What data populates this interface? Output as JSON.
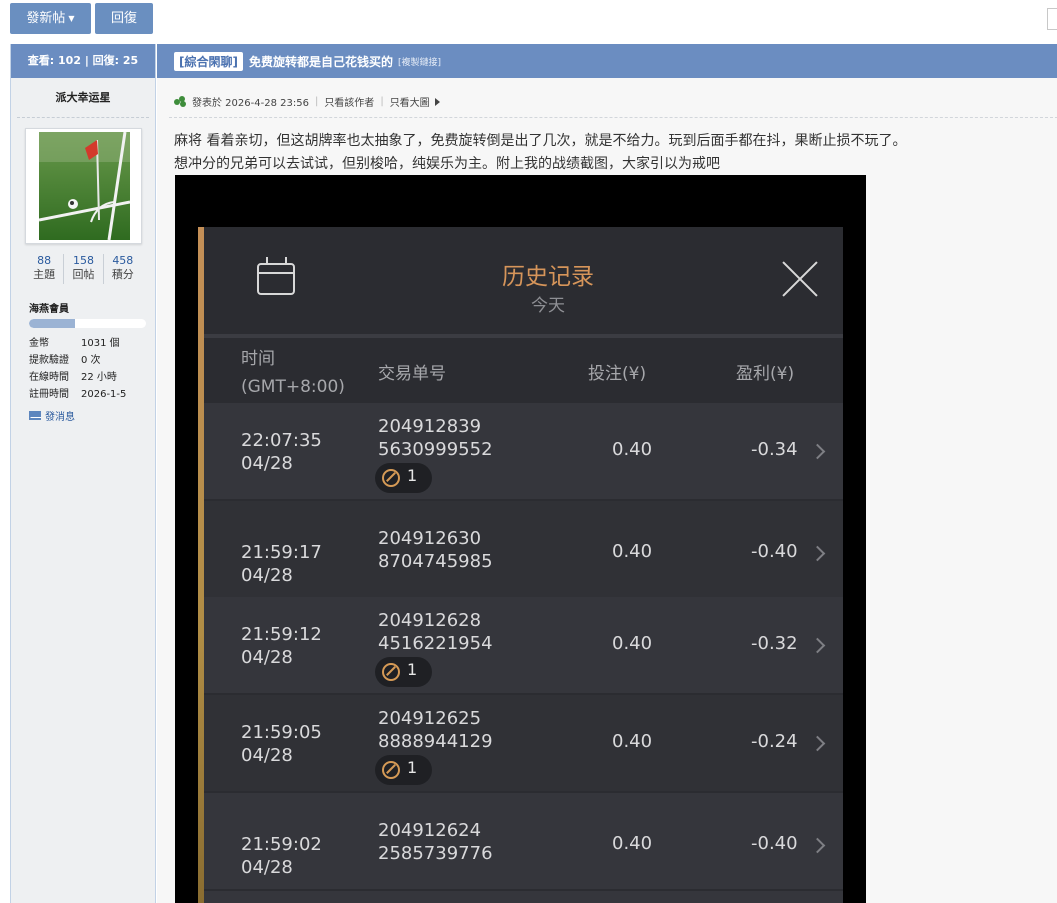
{
  "toolbar": {
    "new_post_label": "發新帖",
    "reply_label": "回復"
  },
  "sidebar": {
    "header": "查看: 102 | 回復: 25",
    "author": "派大幸运星",
    "stats": [
      {
        "num": "88",
        "label": "主題"
      },
      {
        "num": "158",
        "label": "回帖"
      },
      {
        "num": "458",
        "label": "積分"
      }
    ],
    "group": "海燕會員",
    "level_progress": 0.39,
    "info": [
      {
        "k": "金幣",
        "v": "1031 個"
      },
      {
        "k": "提款驗證",
        "v": "0 次"
      },
      {
        "k": "在線時間",
        "v": "22 小時"
      },
      {
        "k": "註冊時間",
        "v": "2026-1-5"
      }
    ],
    "pm_label": "發消息"
  },
  "post": {
    "category": "[綜合閑聊]",
    "title": "免费旋转都是自己花钱买的",
    "copy_link": "[複製鏈接]",
    "posted_at": "發表於 2026-4-28 23:56",
    "only_author": "只看該作者",
    "only_big_image": "只看大圖",
    "body_line1": "麻将 看着亲切，但这胡牌率也太抽象了，免费旋转倒是出了几次，就是不给力。玩到后面手都在抖，果断止损不玩了。",
    "body_line2": "想冲分的兄弟可以去试试，但别梭哈，纯娱乐为主。附上我的战绩截图，大家引以为戒吧"
  },
  "screenshot": {
    "title": "历史记录",
    "subtitle": "今天",
    "columns": {
      "time_line1": "时间",
      "time_line2": "(GMT+8:00)",
      "id": "交易单号",
      "bet": "投注(¥)",
      "profit": "盈利(¥)"
    },
    "rows": [
      {
        "time": "22:07:35",
        "date": "04/28",
        "id1": "204912839",
        "id2": "5630999552",
        "bet": "0.40",
        "profit": "-0.34",
        "badge": "1"
      },
      {
        "time": "21:59:17",
        "date": "04/28",
        "id1": "204912630",
        "id2": "8704745985",
        "bet": "0.40",
        "profit": "-0.40",
        "badge": ""
      },
      {
        "time": "21:59:12",
        "date": "04/28",
        "id1": "204912628",
        "id2": "4516221954",
        "bet": "0.40",
        "profit": "-0.32",
        "badge": "1"
      },
      {
        "time": "21:59:05",
        "date": "04/28",
        "id1": "204912625",
        "id2": "8888944129",
        "bet": "0.40",
        "profit": "-0.24",
        "badge": "1"
      },
      {
        "time": "21:59:02",
        "date": "04/28",
        "id1": "204912624",
        "id2": "2585739776",
        "bet": "0.40",
        "profit": "-0.40",
        "badge": ""
      }
    ]
  },
  "colors": {
    "header_blue": "#6b8dc1",
    "button_blue": "#6a8fc0",
    "accent_gold": "#d6955a"
  }
}
